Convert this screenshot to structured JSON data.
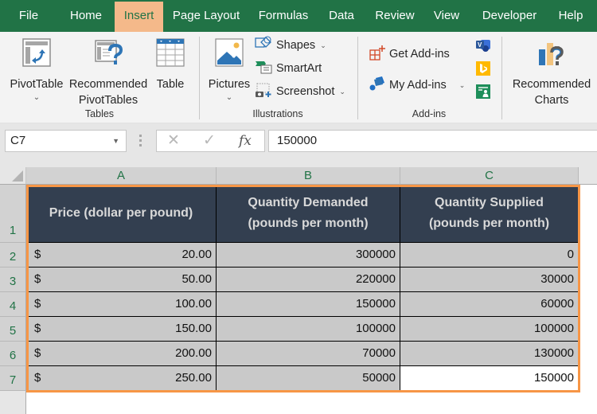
{
  "tabs": [
    {
      "label": "File",
      "active": false
    },
    {
      "label": "Home",
      "active": false
    },
    {
      "label": "Insert",
      "active": true
    },
    {
      "label": "Page Layout",
      "active": false
    },
    {
      "label": "Formulas",
      "active": false
    },
    {
      "label": "Data",
      "active": false
    },
    {
      "label": "Review",
      "active": false
    },
    {
      "label": "View",
      "active": false
    },
    {
      "label": "Developer",
      "active": false
    },
    {
      "label": "Help",
      "active": false
    }
  ],
  "ribbon": {
    "groups": {
      "tables": "Tables",
      "illustrations": "Illustrations",
      "addins": "Add-ins"
    },
    "pivot_table": "PivotTable",
    "recommended_pivot_line1": "Recommended",
    "recommended_pivot_line2": "PivotTables",
    "table": "Table",
    "pictures": "Pictures",
    "shapes": "Shapes",
    "smartart": "SmartArt",
    "screenshot": "Screenshot",
    "get_addins": "Get Add-ins",
    "my_addins": "My Add-ins",
    "recommended_charts_line1": "Recommended",
    "recommended_charts_line2": "Charts",
    "caret": "⌄"
  },
  "formula_bar": {
    "name_box": "C7",
    "cancel": "✕",
    "enter": "✓",
    "fx": "fx",
    "value": "150000"
  },
  "grid": {
    "columns": [
      "A",
      "B",
      "C"
    ],
    "rows": [
      "1",
      "2",
      "3",
      "4",
      "5",
      "6",
      "7"
    ],
    "headers": [
      "Price (dollar per pound)",
      "Quantity Demanded (pounds per month)",
      "Quantity Supplied (pounds per month)"
    ],
    "currency_symbol": "$",
    "data": [
      {
        "price": "20.00",
        "demanded": "300000",
        "supplied": "0"
      },
      {
        "price": "50.00",
        "demanded": "220000",
        "supplied": "30000"
      },
      {
        "price": "100.00",
        "demanded": "150000",
        "supplied": "60000"
      },
      {
        "price": "150.00",
        "demanded": "100000",
        "supplied": "100000"
      },
      {
        "price": "200.00",
        "demanded": "70000",
        "supplied": "130000"
      },
      {
        "price": "250.00",
        "demanded": "50000",
        "supplied": "150000"
      }
    ],
    "active_cell": "C7"
  },
  "colors": {
    "excel_green": "#217346",
    "active_tab": "#F4B98A",
    "header_fill": "#333F50",
    "data_fill": "#C9C9C9",
    "selection_border": "#F79646"
  }
}
